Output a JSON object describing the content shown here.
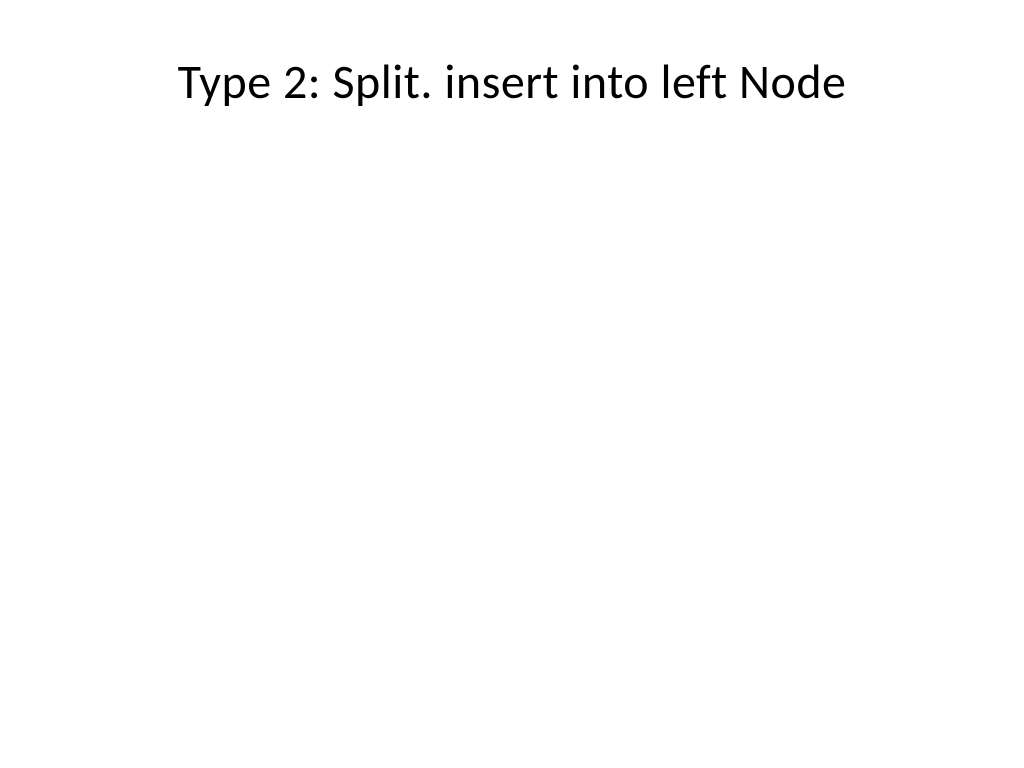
{
  "slide": {
    "title": "Type 2: Split. insert into left Node"
  }
}
